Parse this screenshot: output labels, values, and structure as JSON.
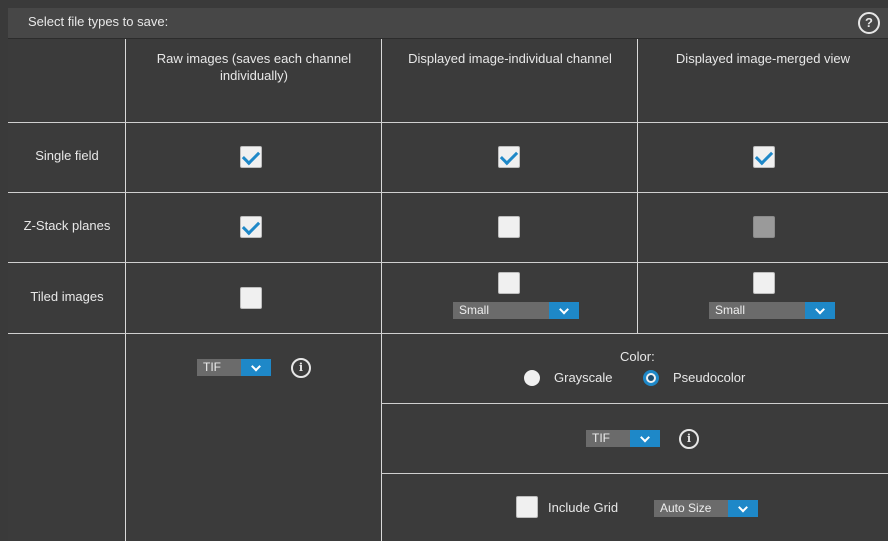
{
  "header": {
    "title": "Select file types to save:",
    "help_icon": "?"
  },
  "columns": {
    "raw": "Raw images (saves each channel individually)",
    "individual": "Displayed image-individual channel",
    "merged": "Displayed image-merged view"
  },
  "rows": {
    "single": "Single field",
    "zstack": "Z-Stack planes",
    "tiled": "Tiled images"
  },
  "checkboxes": {
    "single_raw": true,
    "single_individual": true,
    "single_merged": true,
    "zstack_raw": true,
    "zstack_individual": false,
    "zstack_merged": "disabled",
    "tiled_raw": false,
    "tiled_individual": false,
    "tiled_merged": false
  },
  "tiled_size": {
    "individual": "Small",
    "merged": "Small"
  },
  "raw_format": "TIF",
  "displayed_format": "TIF",
  "info_icon": "i",
  "color": {
    "label": "Color:",
    "options": [
      "Grayscale",
      "Pseudocolor"
    ],
    "selected": "Pseudocolor"
  },
  "grid": {
    "label": "Include Grid",
    "checked": false,
    "size": "Auto Size"
  },
  "accent_color": "#1e88c8"
}
